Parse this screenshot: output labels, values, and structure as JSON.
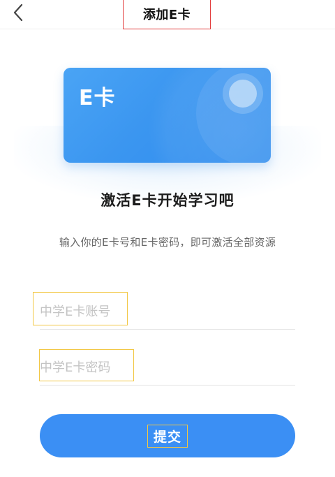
{
  "header": {
    "title": "添加E卡",
    "back_icon": "chevron-left-icon"
  },
  "card": {
    "label": "E卡",
    "colors": {
      "primary": "#3b96f0",
      "accent_highlight": "#f2c744",
      "title_highlight": "#e23b3b"
    }
  },
  "main": {
    "heading": "激活E卡开始学习吧",
    "subtitle": "输入你的E卡号和E卡密码，即可激活全部资源"
  },
  "form": {
    "account": {
      "placeholder": "中学E卡账号",
      "value": ""
    },
    "password": {
      "placeholder": "中学E卡密码",
      "value": ""
    },
    "submit_label": "提交"
  }
}
